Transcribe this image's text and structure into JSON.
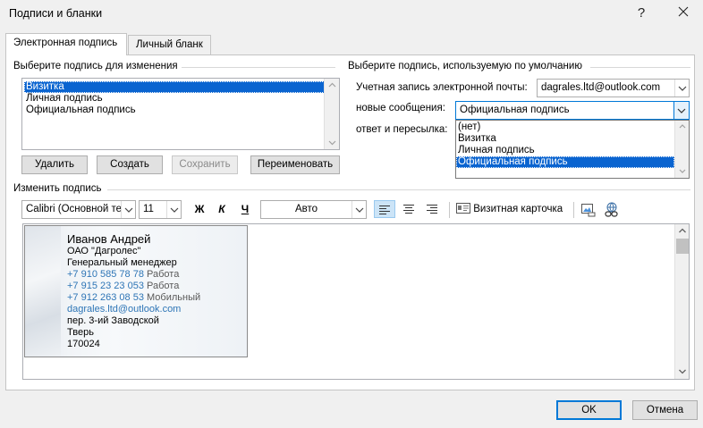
{
  "window": {
    "title": "Подписи и бланки",
    "help": "?",
    "close": "✕"
  },
  "tabs": [
    {
      "label": "Электронная подпись",
      "active": true
    },
    {
      "label": "Личный бланк",
      "active": false
    }
  ],
  "select_signature": {
    "label": "Выберите подпись для изменения",
    "items": [
      "Визитка",
      "Личная подпись",
      "Официальная подпись"
    ],
    "selected": "Визитка"
  },
  "buttons": {
    "delete": "Удалить",
    "create": "Создать",
    "save": "Сохранить",
    "rename": "Переименовать",
    "ok": "OK",
    "cancel": "Отмена"
  },
  "defaults": {
    "label": "Выберите подпись, используемую по умолчанию",
    "account_label": "Учетная запись электронной почты:",
    "account_value": "dagrales.ltd@outlook.com",
    "new_messages_label": "новые сообщения:",
    "new_messages_value": "Официальная подпись",
    "reply_label": "ответ и пересылка:",
    "dropdown_options": [
      "(нет)",
      "Визитка",
      "Личная подпись",
      "Официальная подпись"
    ],
    "dropdown_selected": "Официальная подпись"
  },
  "edit": {
    "label": "Изменить подпись",
    "font": "Calibri (Основной те",
    "size": "11",
    "bold": "Ж",
    "italic": "К",
    "underline": "Ч",
    "color": "Авто",
    "business_card": "Визитная карточка"
  },
  "card": {
    "name": "Иванов Андрей",
    "company": "ОАО \"Дагролес\"",
    "position": "Генеральный менеджер",
    "phones": [
      {
        "number": "+7 910 585 78 78",
        "type": "Работа"
      },
      {
        "number": "+7 915 23 23 053",
        "type": "Работа"
      },
      {
        "number": "+7 912 263 08 53",
        "type": "Мобильный"
      }
    ],
    "email": "dagrales.ltd@outlook.com",
    "street": "пер. 3-ий Заводской",
    "city": "Тверь",
    "zip": "170024"
  },
  "colors": {
    "selection": "#0a64d0",
    "link_blue": "#2e75b6",
    "accent": "#0078d7"
  }
}
